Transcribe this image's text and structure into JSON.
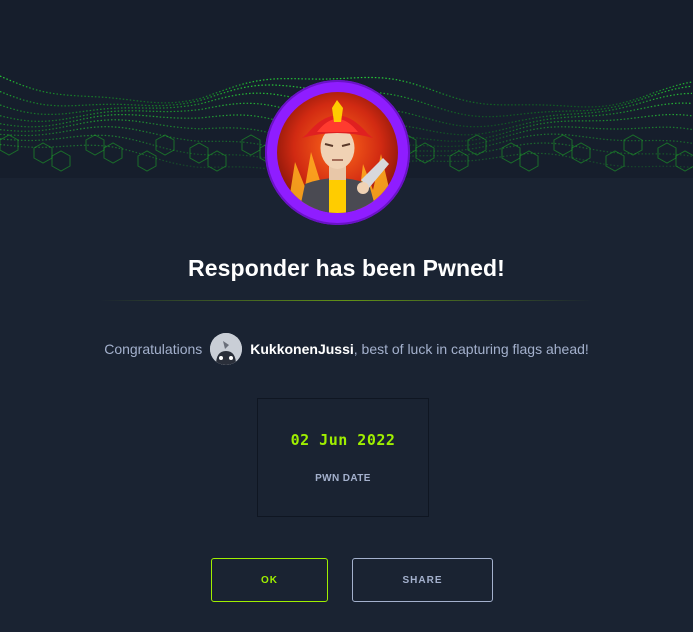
{
  "modal": {
    "title": "Responder has been Pwned!",
    "congrats_prefix": "Congratulations",
    "username": "KukkonenJussi",
    "congrats_suffix": ", best of luck in capturing flags ahead!",
    "pwn_date": "02 Jun 2022",
    "pwn_date_label": "PWN DATE",
    "ok_label": "OK",
    "share_label": "SHARE"
  },
  "icons": {
    "machine_avatar": "firefighter-avatar-icon",
    "user_avatar": "user-avatar-icon"
  },
  "colors": {
    "background": "#1a2332",
    "accent_green": "#9fef00",
    "avatar_ring": "#8f1dff",
    "muted_text": "#a4b1cd"
  }
}
